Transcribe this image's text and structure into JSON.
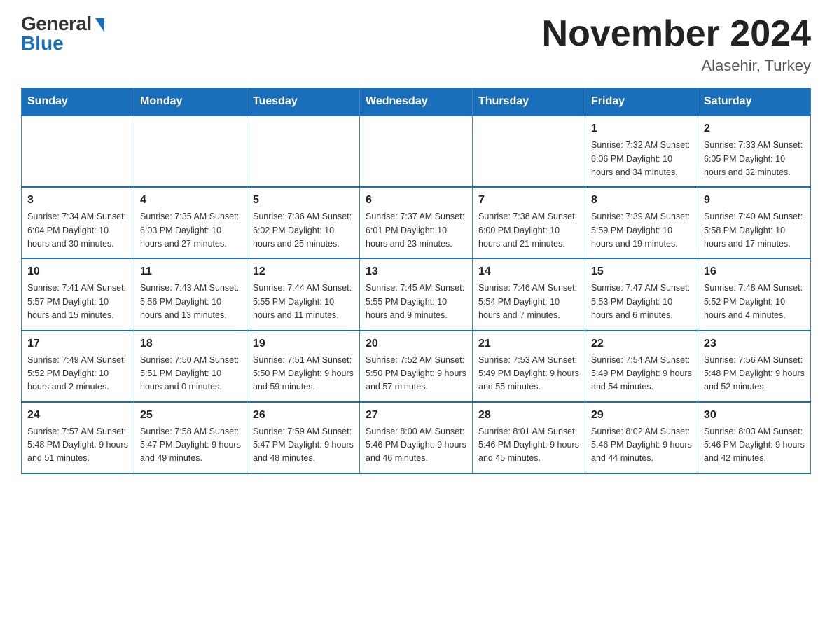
{
  "logo": {
    "general": "General",
    "blue": "Blue"
  },
  "title": "November 2024",
  "location": "Alasehir, Turkey",
  "weekdays": [
    "Sunday",
    "Monday",
    "Tuesday",
    "Wednesday",
    "Thursday",
    "Friday",
    "Saturday"
  ],
  "weeks": [
    [
      {
        "day": "",
        "info": ""
      },
      {
        "day": "",
        "info": ""
      },
      {
        "day": "",
        "info": ""
      },
      {
        "day": "",
        "info": ""
      },
      {
        "day": "",
        "info": ""
      },
      {
        "day": "1",
        "info": "Sunrise: 7:32 AM\nSunset: 6:06 PM\nDaylight: 10 hours\nand 34 minutes."
      },
      {
        "day": "2",
        "info": "Sunrise: 7:33 AM\nSunset: 6:05 PM\nDaylight: 10 hours\nand 32 minutes."
      }
    ],
    [
      {
        "day": "3",
        "info": "Sunrise: 7:34 AM\nSunset: 6:04 PM\nDaylight: 10 hours\nand 30 minutes."
      },
      {
        "day": "4",
        "info": "Sunrise: 7:35 AM\nSunset: 6:03 PM\nDaylight: 10 hours\nand 27 minutes."
      },
      {
        "day": "5",
        "info": "Sunrise: 7:36 AM\nSunset: 6:02 PM\nDaylight: 10 hours\nand 25 minutes."
      },
      {
        "day": "6",
        "info": "Sunrise: 7:37 AM\nSunset: 6:01 PM\nDaylight: 10 hours\nand 23 minutes."
      },
      {
        "day": "7",
        "info": "Sunrise: 7:38 AM\nSunset: 6:00 PM\nDaylight: 10 hours\nand 21 minutes."
      },
      {
        "day": "8",
        "info": "Sunrise: 7:39 AM\nSunset: 5:59 PM\nDaylight: 10 hours\nand 19 minutes."
      },
      {
        "day": "9",
        "info": "Sunrise: 7:40 AM\nSunset: 5:58 PM\nDaylight: 10 hours\nand 17 minutes."
      }
    ],
    [
      {
        "day": "10",
        "info": "Sunrise: 7:41 AM\nSunset: 5:57 PM\nDaylight: 10 hours\nand 15 minutes."
      },
      {
        "day": "11",
        "info": "Sunrise: 7:43 AM\nSunset: 5:56 PM\nDaylight: 10 hours\nand 13 minutes."
      },
      {
        "day": "12",
        "info": "Sunrise: 7:44 AM\nSunset: 5:55 PM\nDaylight: 10 hours\nand 11 minutes."
      },
      {
        "day": "13",
        "info": "Sunrise: 7:45 AM\nSunset: 5:55 PM\nDaylight: 10 hours\nand 9 minutes."
      },
      {
        "day": "14",
        "info": "Sunrise: 7:46 AM\nSunset: 5:54 PM\nDaylight: 10 hours\nand 7 minutes."
      },
      {
        "day": "15",
        "info": "Sunrise: 7:47 AM\nSunset: 5:53 PM\nDaylight: 10 hours\nand 6 minutes."
      },
      {
        "day": "16",
        "info": "Sunrise: 7:48 AM\nSunset: 5:52 PM\nDaylight: 10 hours\nand 4 minutes."
      }
    ],
    [
      {
        "day": "17",
        "info": "Sunrise: 7:49 AM\nSunset: 5:52 PM\nDaylight: 10 hours\nand 2 minutes."
      },
      {
        "day": "18",
        "info": "Sunrise: 7:50 AM\nSunset: 5:51 PM\nDaylight: 10 hours\nand 0 minutes."
      },
      {
        "day": "19",
        "info": "Sunrise: 7:51 AM\nSunset: 5:50 PM\nDaylight: 9 hours\nand 59 minutes."
      },
      {
        "day": "20",
        "info": "Sunrise: 7:52 AM\nSunset: 5:50 PM\nDaylight: 9 hours\nand 57 minutes."
      },
      {
        "day": "21",
        "info": "Sunrise: 7:53 AM\nSunset: 5:49 PM\nDaylight: 9 hours\nand 55 minutes."
      },
      {
        "day": "22",
        "info": "Sunrise: 7:54 AM\nSunset: 5:49 PM\nDaylight: 9 hours\nand 54 minutes."
      },
      {
        "day": "23",
        "info": "Sunrise: 7:56 AM\nSunset: 5:48 PM\nDaylight: 9 hours\nand 52 minutes."
      }
    ],
    [
      {
        "day": "24",
        "info": "Sunrise: 7:57 AM\nSunset: 5:48 PM\nDaylight: 9 hours\nand 51 minutes."
      },
      {
        "day": "25",
        "info": "Sunrise: 7:58 AM\nSunset: 5:47 PM\nDaylight: 9 hours\nand 49 minutes."
      },
      {
        "day": "26",
        "info": "Sunrise: 7:59 AM\nSunset: 5:47 PM\nDaylight: 9 hours\nand 48 minutes."
      },
      {
        "day": "27",
        "info": "Sunrise: 8:00 AM\nSunset: 5:46 PM\nDaylight: 9 hours\nand 46 minutes."
      },
      {
        "day": "28",
        "info": "Sunrise: 8:01 AM\nSunset: 5:46 PM\nDaylight: 9 hours\nand 45 minutes."
      },
      {
        "day": "29",
        "info": "Sunrise: 8:02 AM\nSunset: 5:46 PM\nDaylight: 9 hours\nand 44 minutes."
      },
      {
        "day": "30",
        "info": "Sunrise: 8:03 AM\nSunset: 5:46 PM\nDaylight: 9 hours\nand 42 minutes."
      }
    ]
  ]
}
